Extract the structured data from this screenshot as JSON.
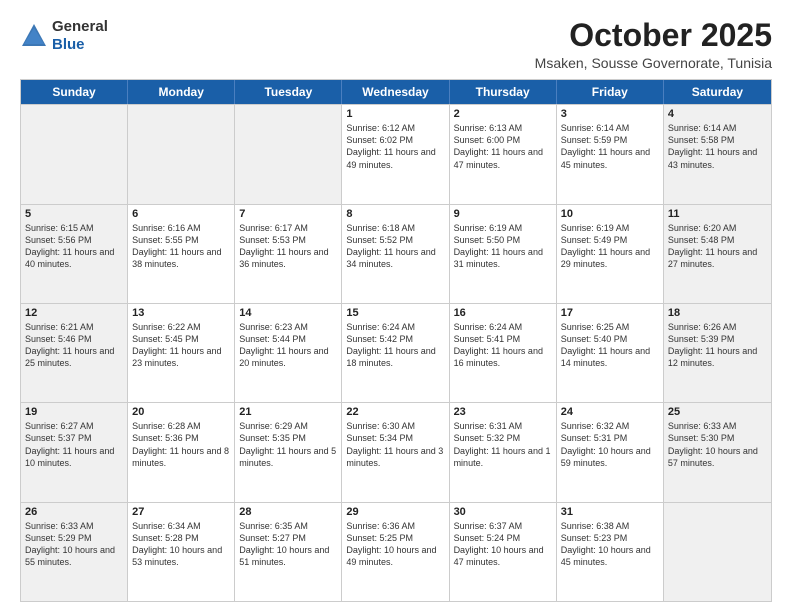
{
  "header": {
    "logo_general": "General",
    "logo_blue": "Blue",
    "month": "October 2025",
    "location": "Msaken, Sousse Governorate, Tunisia"
  },
  "days_of_week": [
    "Sunday",
    "Monday",
    "Tuesday",
    "Wednesday",
    "Thursday",
    "Friday",
    "Saturday"
  ],
  "weeks": [
    [
      {
        "day": "",
        "text": "",
        "shaded": true
      },
      {
        "day": "",
        "text": "",
        "shaded": true
      },
      {
        "day": "",
        "text": "",
        "shaded": true
      },
      {
        "day": "1",
        "text": "Sunrise: 6:12 AM\nSunset: 6:02 PM\nDaylight: 11 hours and 49 minutes.",
        "shaded": false
      },
      {
        "day": "2",
        "text": "Sunrise: 6:13 AM\nSunset: 6:00 PM\nDaylight: 11 hours and 47 minutes.",
        "shaded": false
      },
      {
        "day": "3",
        "text": "Sunrise: 6:14 AM\nSunset: 5:59 PM\nDaylight: 11 hours and 45 minutes.",
        "shaded": false
      },
      {
        "day": "4",
        "text": "Sunrise: 6:14 AM\nSunset: 5:58 PM\nDaylight: 11 hours and 43 minutes.",
        "shaded": true
      }
    ],
    [
      {
        "day": "5",
        "text": "Sunrise: 6:15 AM\nSunset: 5:56 PM\nDaylight: 11 hours and 40 minutes.",
        "shaded": true
      },
      {
        "day": "6",
        "text": "Sunrise: 6:16 AM\nSunset: 5:55 PM\nDaylight: 11 hours and 38 minutes.",
        "shaded": false
      },
      {
        "day": "7",
        "text": "Sunrise: 6:17 AM\nSunset: 5:53 PM\nDaylight: 11 hours and 36 minutes.",
        "shaded": false
      },
      {
        "day": "8",
        "text": "Sunrise: 6:18 AM\nSunset: 5:52 PM\nDaylight: 11 hours and 34 minutes.",
        "shaded": false
      },
      {
        "day": "9",
        "text": "Sunrise: 6:19 AM\nSunset: 5:50 PM\nDaylight: 11 hours and 31 minutes.",
        "shaded": false
      },
      {
        "day": "10",
        "text": "Sunrise: 6:19 AM\nSunset: 5:49 PM\nDaylight: 11 hours and 29 minutes.",
        "shaded": false
      },
      {
        "day": "11",
        "text": "Sunrise: 6:20 AM\nSunset: 5:48 PM\nDaylight: 11 hours and 27 minutes.",
        "shaded": true
      }
    ],
    [
      {
        "day": "12",
        "text": "Sunrise: 6:21 AM\nSunset: 5:46 PM\nDaylight: 11 hours and 25 minutes.",
        "shaded": true
      },
      {
        "day": "13",
        "text": "Sunrise: 6:22 AM\nSunset: 5:45 PM\nDaylight: 11 hours and 23 minutes.",
        "shaded": false
      },
      {
        "day": "14",
        "text": "Sunrise: 6:23 AM\nSunset: 5:44 PM\nDaylight: 11 hours and 20 minutes.",
        "shaded": false
      },
      {
        "day": "15",
        "text": "Sunrise: 6:24 AM\nSunset: 5:42 PM\nDaylight: 11 hours and 18 minutes.",
        "shaded": false
      },
      {
        "day": "16",
        "text": "Sunrise: 6:24 AM\nSunset: 5:41 PM\nDaylight: 11 hours and 16 minutes.",
        "shaded": false
      },
      {
        "day": "17",
        "text": "Sunrise: 6:25 AM\nSunset: 5:40 PM\nDaylight: 11 hours and 14 minutes.",
        "shaded": false
      },
      {
        "day": "18",
        "text": "Sunrise: 6:26 AM\nSunset: 5:39 PM\nDaylight: 11 hours and 12 minutes.",
        "shaded": true
      }
    ],
    [
      {
        "day": "19",
        "text": "Sunrise: 6:27 AM\nSunset: 5:37 PM\nDaylight: 11 hours and 10 minutes.",
        "shaded": true
      },
      {
        "day": "20",
        "text": "Sunrise: 6:28 AM\nSunset: 5:36 PM\nDaylight: 11 hours and 8 minutes.",
        "shaded": false
      },
      {
        "day": "21",
        "text": "Sunrise: 6:29 AM\nSunset: 5:35 PM\nDaylight: 11 hours and 5 minutes.",
        "shaded": false
      },
      {
        "day": "22",
        "text": "Sunrise: 6:30 AM\nSunset: 5:34 PM\nDaylight: 11 hours and 3 minutes.",
        "shaded": false
      },
      {
        "day": "23",
        "text": "Sunrise: 6:31 AM\nSunset: 5:32 PM\nDaylight: 11 hours and 1 minute.",
        "shaded": false
      },
      {
        "day": "24",
        "text": "Sunrise: 6:32 AM\nSunset: 5:31 PM\nDaylight: 10 hours and 59 minutes.",
        "shaded": false
      },
      {
        "day": "25",
        "text": "Sunrise: 6:33 AM\nSunset: 5:30 PM\nDaylight: 10 hours and 57 minutes.",
        "shaded": true
      }
    ],
    [
      {
        "day": "26",
        "text": "Sunrise: 6:33 AM\nSunset: 5:29 PM\nDaylight: 10 hours and 55 minutes.",
        "shaded": true
      },
      {
        "day": "27",
        "text": "Sunrise: 6:34 AM\nSunset: 5:28 PM\nDaylight: 10 hours and 53 minutes.",
        "shaded": false
      },
      {
        "day": "28",
        "text": "Sunrise: 6:35 AM\nSunset: 5:27 PM\nDaylight: 10 hours and 51 minutes.",
        "shaded": false
      },
      {
        "day": "29",
        "text": "Sunrise: 6:36 AM\nSunset: 5:25 PM\nDaylight: 10 hours and 49 minutes.",
        "shaded": false
      },
      {
        "day": "30",
        "text": "Sunrise: 6:37 AM\nSunset: 5:24 PM\nDaylight: 10 hours and 47 minutes.",
        "shaded": false
      },
      {
        "day": "31",
        "text": "Sunrise: 6:38 AM\nSunset: 5:23 PM\nDaylight: 10 hours and 45 minutes.",
        "shaded": false
      },
      {
        "day": "",
        "text": "",
        "shaded": true
      }
    ]
  ]
}
